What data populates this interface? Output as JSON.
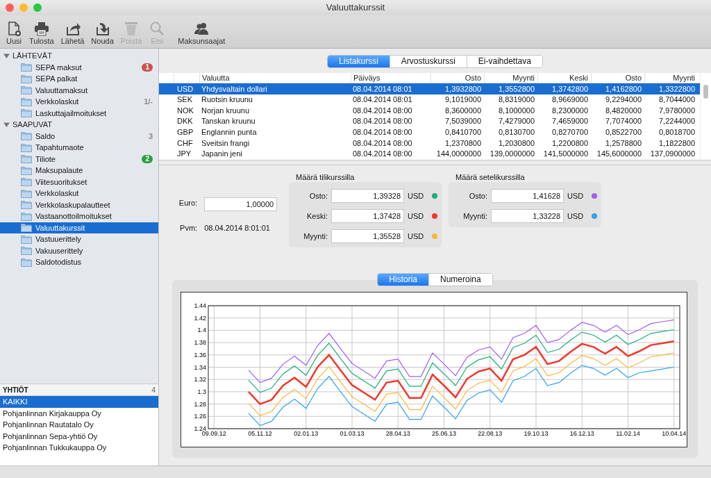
{
  "window": {
    "title": "Valuuttakurssit"
  },
  "toolbar": [
    {
      "label": "Uusi",
      "disabled": false
    },
    {
      "label": "Tulosta",
      "disabled": false
    },
    {
      "label": "Lähetä",
      "disabled": false
    },
    {
      "label": "Nouda",
      "disabled": false
    },
    {
      "label": "Poista",
      "disabled": true
    },
    {
      "label": "Etsi",
      "disabled": true
    },
    {
      "label": "Maksunsaajat",
      "disabled": false
    }
  ],
  "sidebar": {
    "sections": [
      {
        "label": "LÄHTEVÄT",
        "expanded": true,
        "children": [
          {
            "label": "SEPA maksut",
            "selected": false,
            "badge": {
              "text": "1",
              "color": "#cb524d"
            }
          },
          {
            "label": "SEPA palkat",
            "selected": false
          },
          {
            "label": "Valuuttamaksut",
            "selected": false
          },
          {
            "label": "Verkkolaskut",
            "selected": false,
            "count": "1/-"
          },
          {
            "label": "Laskuttajailmoitukset",
            "selected": false
          }
        ]
      },
      {
        "label": "SAAPUVAT",
        "expanded": true,
        "children": [
          {
            "label": "Saldo",
            "selected": false,
            "count": "3"
          },
          {
            "label": "Tapahtumaote",
            "selected": false
          },
          {
            "label": "Tiliote",
            "selected": false,
            "badge": {
              "text": "2",
              "color": "#2e9e45"
            }
          },
          {
            "label": "Maksupalaute",
            "selected": false
          },
          {
            "label": "Viitesuoritukset",
            "selected": false
          },
          {
            "label": "Verkkolaskut",
            "selected": false
          },
          {
            "label": "Verkkolaskupalautteet",
            "selected": false
          },
          {
            "label": "Vastaanottoilmoitukset",
            "selected": false
          },
          {
            "label": "Valuuttakurssit",
            "selected": true
          },
          {
            "label": "Vastuuerittely",
            "selected": false
          },
          {
            "label": "Vakuuserittely",
            "selected": false
          },
          {
            "label": "Saldotodistus",
            "selected": false
          }
        ]
      }
    ]
  },
  "companies": {
    "title": "YHTIÖT",
    "count": "4",
    "items": [
      {
        "label": "KAIKKI",
        "selected": true
      },
      {
        "label": "Pohjanlinnan Kirjakauppa Oy",
        "selected": false
      },
      {
        "label": "Pohjanlinnan Rautatalo Oy",
        "selected": false
      },
      {
        "label": "Pohjanlinnan Sepa-yhtiö Oy",
        "selected": false
      },
      {
        "label": "Pohjanlinnan Tukkukauppa Oy",
        "selected": false
      }
    ]
  },
  "rate_tabs": [
    {
      "label": "Listakurssi",
      "selected": true
    },
    {
      "label": "Arvostuskurssi",
      "selected": false
    },
    {
      "label": "Ei-vaihdettava",
      "selected": false
    }
  ],
  "table": {
    "columns": [
      "Valuutta",
      "Päiväys",
      "Osto",
      "Myynti",
      "Keski",
      "Osto",
      "Myynti"
    ],
    "rows": [
      {
        "selected": true,
        "code": "USD",
        "cells": [
          "Yhdysvaltain dollari",
          "08.04.2014 08:01",
          "1,3932800",
          "1,3552800",
          "1,3742800",
          "1,4162800",
          "1,3322800"
        ]
      },
      {
        "selected": false,
        "code": "SEK",
        "cells": [
          "Ruotsin kruunu",
          "08.04.2014 08:01",
          "9,1019000",
          "8,8319000",
          "8,9669000",
          "9,2294000",
          "8,7044000"
        ]
      },
      {
        "selected": false,
        "code": "NOK",
        "cells": [
          "Norjan kruunu",
          "08.04.2014 08:00",
          "8,3600000",
          "8,1000000",
          "8,2300000",
          "8,4820000",
          "7,9780000"
        ]
      },
      {
        "selected": false,
        "code": "DKK",
        "cells": [
          "Tanskan kruunu",
          "08.04.2014 08:00",
          "7,5039000",
          "7,4279000",
          "7,4659000",
          "7,7074000",
          "7,2244000"
        ]
      },
      {
        "selected": false,
        "code": "GBP",
        "cells": [
          "Englannin punta",
          "08.04.2014 08:00",
          "0,8410700",
          "0,8130700",
          "0,8270700",
          "0,8522700",
          "0,8018700"
        ]
      },
      {
        "selected": false,
        "code": "CHF",
        "cells": [
          "Sveitsin frangi",
          "08.04.2014 08:00",
          "1,2370800",
          "1,2030800",
          "1,2200800",
          "1,2578800",
          "1,1822800"
        ]
      },
      {
        "selected": false,
        "code": "JPY",
        "cells": [
          "Japanin jeni",
          "08.04.2014 08:00",
          "144,0000000",
          "139,0000000",
          "141,5000000",
          "145,6000000",
          "137,0900000"
        ]
      }
    ]
  },
  "converter": {
    "euro_label": "Euro:",
    "euro_value": "1,00000",
    "date_label": "Pvm:",
    "date_value": "08.04.2014 8:01:01",
    "groups": [
      {
        "title": "Määrä tilikurssilla",
        "rows": [
          {
            "label": "Osto:",
            "value": "1,39328",
            "currency": "USD",
            "color": "#1aae79"
          },
          {
            "label": "Keski:",
            "value": "1,37428",
            "currency": "USD",
            "color": "#f5352a"
          },
          {
            "label": "Myynti:",
            "value": "1,35528",
            "currency": "USD",
            "color": "#fbb63a"
          }
        ]
      },
      {
        "title": "Määrä setelikurssilla",
        "rows": [
          {
            "label": "Osto:",
            "value": "1,41628",
            "currency": "USD",
            "color": "#a25df1"
          },
          {
            "label": "Myynti:",
            "value": "1,33228",
            "currency": "USD",
            "color": "#2fa2f2"
          }
        ]
      }
    ]
  },
  "chart_tabs": [
    {
      "label": "Historia",
      "selected": true
    },
    {
      "label": "Numeroina",
      "selected": false
    }
  ],
  "chart_data": {
    "type": "line",
    "grid": true,
    "ylim": [
      1.24,
      1.44
    ],
    "categories": [
      "09.09.12",
      null,
      null,
      null,
      "05.11.12",
      null,
      null,
      null,
      "02.01.13",
      null,
      null,
      null,
      "01.03.13",
      null,
      null,
      null,
      "28.04.13",
      null,
      null,
      null,
      "25.06.13",
      null,
      null,
      null,
      "22.08.13",
      null,
      null,
      null,
      "19.10.13",
      null,
      null,
      null,
      "16.12.13",
      null,
      null,
      null,
      "11.02.14",
      null,
      null,
      null,
      "10.04.14"
    ],
    "yticks": [
      {
        "value": 1.24,
        "label": "1.24"
      },
      {
        "value": 1.26,
        "label": "1.26"
      },
      {
        "value": 1.28,
        "label": "1.28"
      },
      {
        "value": 1.3,
        "label": "1.3"
      },
      {
        "value": 1.32,
        "label": "1.32"
      },
      {
        "value": 1.34,
        "label": "1.34"
      },
      {
        "value": 1.36,
        "label": "1.36"
      },
      {
        "value": 1.38,
        "label": "1.38"
      },
      {
        "value": 1.4,
        "label": "1.4"
      },
      {
        "value": 1.42,
        "label": "1.42"
      },
      {
        "value": 1.44,
        "label": "1.44"
      }
    ],
    "series": [
      {
        "color": "#a25df1",
        "values": [
          null,
          null,
          null,
          1.335,
          1.315,
          1.322,
          1.345,
          1.358,
          1.343,
          1.375,
          1.395,
          1.37,
          1.346,
          1.334,
          1.322,
          1.35,
          1.353,
          1.325,
          1.325,
          1.363,
          1.345,
          1.326,
          1.356,
          1.368,
          1.373,
          1.353,
          1.388,
          1.395,
          1.408,
          1.38,
          1.385,
          1.4,
          1.413,
          1.408,
          1.397,
          1.408,
          1.393,
          1.401,
          1.411,
          1.414,
          1.417
        ]
      },
      {
        "color": "#1aae79",
        "values": [
          null,
          null,
          null,
          1.319,
          1.299,
          1.306,
          1.329,
          1.342,
          1.327,
          1.359,
          1.379,
          1.354,
          1.33,
          1.318,
          1.306,
          1.334,
          1.337,
          1.309,
          1.309,
          1.347,
          1.329,
          1.31,
          1.34,
          1.352,
          1.357,
          1.337,
          1.372,
          1.379,
          1.392,
          1.364,
          1.369,
          1.384,
          1.397,
          1.392,
          1.381,
          1.392,
          1.377,
          1.385,
          1.395,
          1.398,
          1.401
        ]
      },
      {
        "color": "#f5352a",
        "values": [
          null,
          null,
          null,
          1.3,
          1.28,
          1.287,
          1.31,
          1.323,
          1.308,
          1.34,
          1.36,
          1.335,
          1.311,
          1.299,
          1.287,
          1.315,
          1.318,
          1.29,
          1.29,
          1.328,
          1.31,
          1.291,
          1.321,
          1.333,
          1.338,
          1.318,
          1.353,
          1.36,
          1.373,
          1.345,
          1.35,
          1.365,
          1.378,
          1.373,
          1.362,
          1.373,
          1.358,
          1.366,
          1.376,
          1.379,
          1.382
        ]
      },
      {
        "color": "#fbb63a",
        "values": [
          null,
          null,
          null,
          1.281,
          1.261,
          1.268,
          1.291,
          1.304,
          1.289,
          1.321,
          1.341,
          1.316,
          1.292,
          1.28,
          1.268,
          1.296,
          1.299,
          1.271,
          1.271,
          1.309,
          1.291,
          1.272,
          1.302,
          1.314,
          1.319,
          1.299,
          1.334,
          1.341,
          1.354,
          1.326,
          1.331,
          1.346,
          1.359,
          1.354,
          1.343,
          1.354,
          1.339,
          1.347,
          1.357,
          1.36,
          1.363
        ]
      },
      {
        "color": "#2fa2f2",
        "values": [
          null,
          null,
          null,
          1.265,
          1.245,
          1.252,
          1.275,
          1.288,
          1.273,
          1.305,
          1.325,
          1.3,
          1.276,
          1.264,
          1.252,
          1.28,
          1.283,
          1.255,
          1.255,
          1.293,
          1.275,
          1.256,
          1.286,
          1.298,
          1.303,
          1.283,
          1.318,
          1.325,
          1.338,
          1.31,
          1.315,
          1.33,
          1.343,
          1.338,
          1.327,
          1.338,
          1.323,
          1.331,
          1.334,
          1.337,
          1.34
        ]
      }
    ]
  }
}
